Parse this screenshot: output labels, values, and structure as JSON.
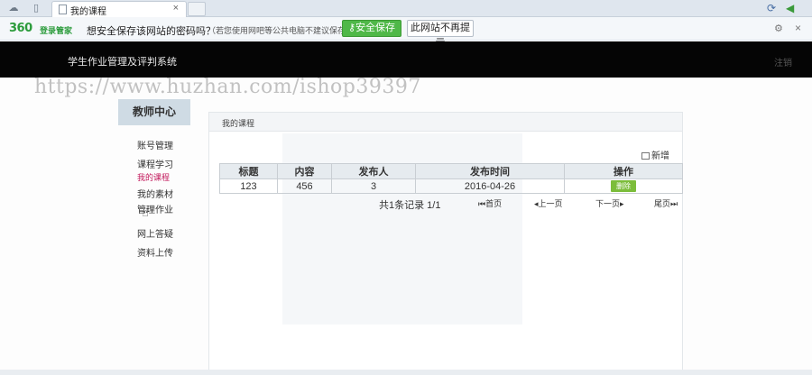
{
  "browser": {
    "tab_title": "我的课程",
    "tab_close": "×",
    "icons": [
      "cloud-icon",
      "book-icon",
      "doc-icon",
      "refresh-icon",
      "back-arrow-icon"
    ]
  },
  "password_bar": {
    "logo": "360",
    "logo_sub": "登录管家",
    "question": "想安全保存该网站的密码吗？",
    "note": "（若您使用网吧等公共电脑不建议保存）",
    "save_label": "安全保存",
    "never_label": "此网站不再提示",
    "close": "×"
  },
  "header": {
    "system_title": "学生作业管理及评判系统",
    "exit_label": "注销"
  },
  "watermark": "https://www.huzhan.com/ishop39397",
  "sidebar": {
    "heading": "教师中心",
    "items": [
      {
        "label": "账号管理"
      },
      {
        "label": "课程学习"
      },
      {
        "label": "我的课程",
        "active": true
      },
      {
        "label": "我的素材"
      },
      {
        "label": "管理作业"
      },
      {
        "label": "网上答疑"
      },
      {
        "label": "资料上传"
      }
    ]
  },
  "main": {
    "panel_title": "我的课程",
    "add_label": "新增",
    "table": {
      "headers": [
        "标题",
        "内容",
        "发布人",
        "发布时间",
        "操作"
      ],
      "rows": [
        {
          "title": "123",
          "content": "456",
          "publisher": "3",
          "date": "2016-04-26",
          "action": "删除"
        }
      ]
    },
    "pager": {
      "info": "共1条记录 1/1",
      "first": "首页",
      "prev": "上一页",
      "next": "下一页",
      "last": "尾页"
    }
  },
  "colors": {
    "header_bg": "#050505",
    "save_green": "#4fb848",
    "action_green": "#7cbd3b",
    "active_link": "#c2185b",
    "sidebar_head": "#cfdbe4"
  }
}
